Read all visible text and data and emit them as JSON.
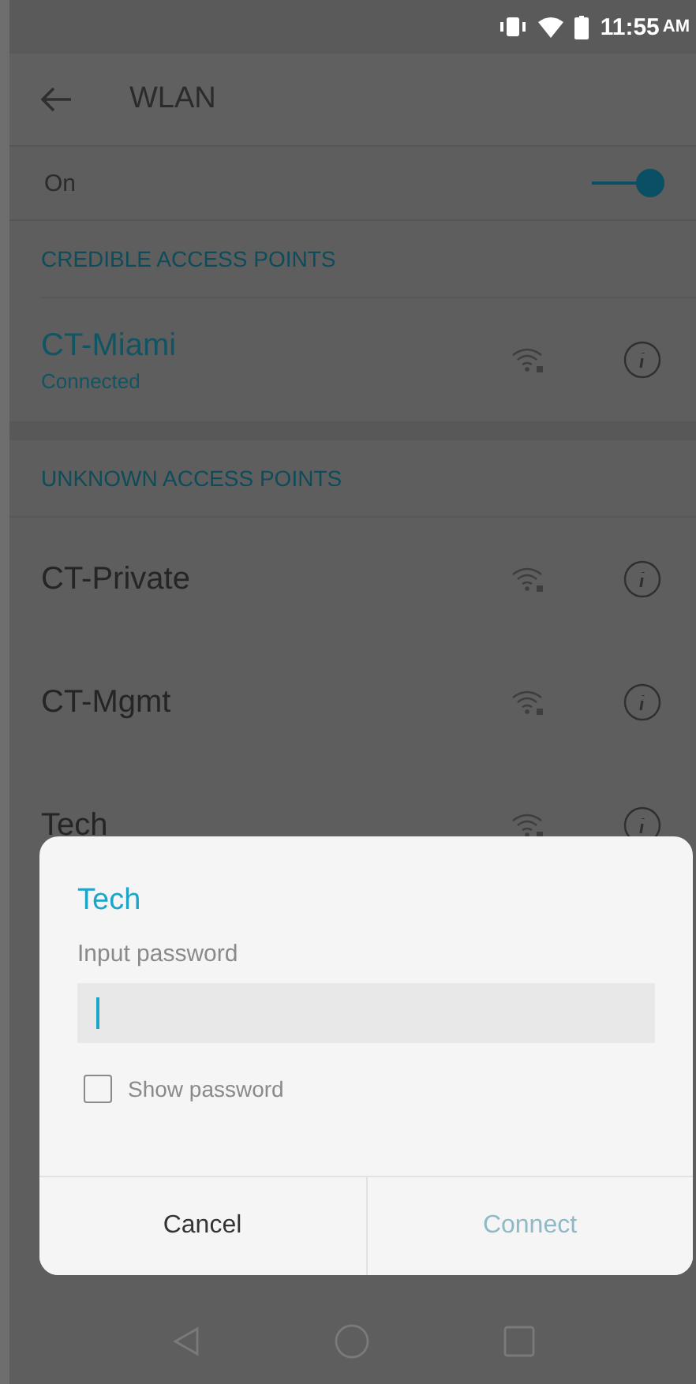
{
  "status_bar": {
    "time": "11:55",
    "ampm": "AM"
  },
  "header": {
    "title": "WLAN"
  },
  "wlan_toggle": {
    "label": "On",
    "on": true
  },
  "sections": [
    {
      "title": "CREDIBLE ACCESS POINTS",
      "networks": [
        {
          "name": "CT-Miami",
          "status": "Connected",
          "connected": true
        }
      ]
    },
    {
      "title": "UNKNOWN ACCESS POINTS",
      "networks": [
        {
          "name": "CT-Private",
          "connected": false
        },
        {
          "name": "CT-Mgmt",
          "connected": false
        },
        {
          "name": "Tech",
          "connected": false
        }
      ]
    }
  ],
  "dialog": {
    "title": "Tech",
    "field_label": "Input password",
    "show_password": {
      "label": "Show password",
      "checked": false
    },
    "buttons": [
      {
        "label": "Cancel",
        "disabled": false
      },
      {
        "label": "Connect",
        "disabled": true
      }
    ]
  }
}
